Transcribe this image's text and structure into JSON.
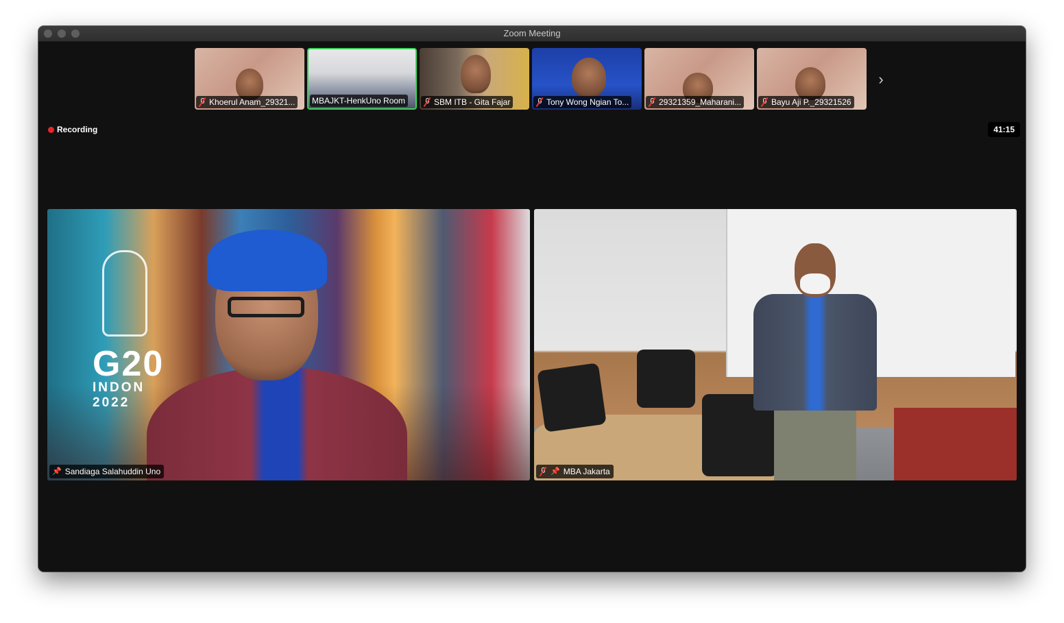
{
  "window": {
    "title": "Zoom Meeting"
  },
  "thumbnails": [
    {
      "name": "Khoerul Anam_29321...",
      "muted": true,
      "active": false,
      "bg": "batik"
    },
    {
      "name": "MBAJKT-HenkUno Room",
      "muted": false,
      "active": true,
      "bg": "room"
    },
    {
      "name": "SBM ITB - Gita Fajar",
      "muted": true,
      "active": false,
      "bg": "home"
    },
    {
      "name": "Tony Wong Ngian To...",
      "muted": true,
      "active": false,
      "bg": "blue"
    },
    {
      "name": "29321359_Maharani...",
      "muted": true,
      "active": false,
      "bg": "batik"
    },
    {
      "name": "Bayu Aji P._29321526",
      "muted": true,
      "active": false,
      "bg": "batik"
    }
  ],
  "status": {
    "recording_label": "Recording",
    "timer": "41:15"
  },
  "video_tiles": [
    {
      "name": "Sandiaga Salahuddin Uno",
      "pinned": true,
      "muted": false
    },
    {
      "name": "MBA Jakarta",
      "pinned": true,
      "muted": true
    }
  ],
  "background_text": {
    "g20": "G20",
    "g20_sub_line1": "INDON",
    "g20_sub_line2": "2022"
  },
  "icons": {
    "next": "chevron-right-icon",
    "muted": "mic-muted-icon",
    "pin": "pin-icon",
    "recording": "record-dot-icon"
  },
  "colors": {
    "active_speaker": "#3dd45c",
    "recording": "#e5272a",
    "muted": "#e53935"
  }
}
